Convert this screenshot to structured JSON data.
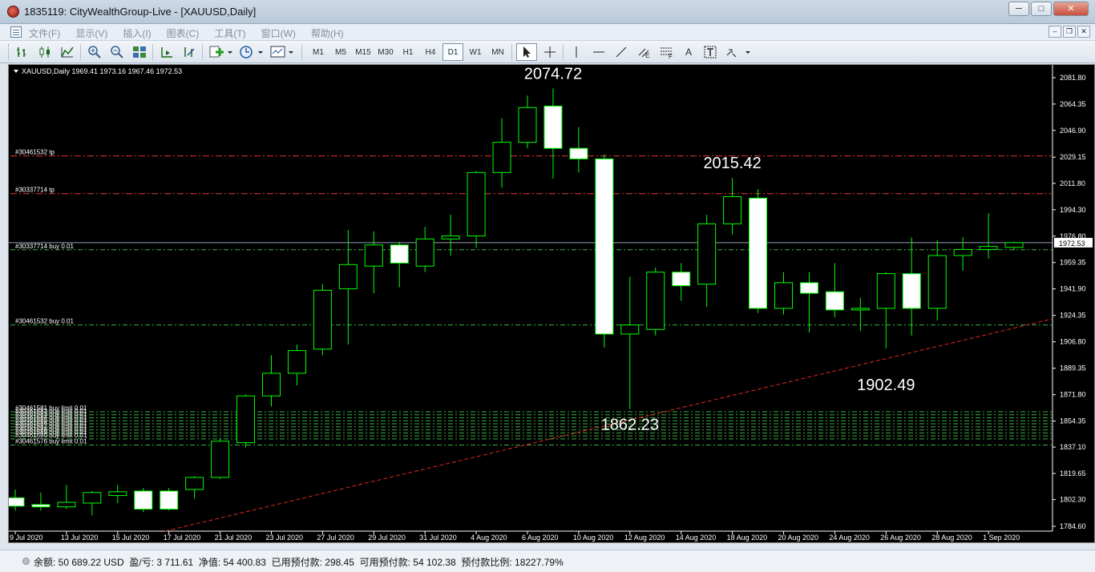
{
  "window": {
    "title": "1835119: CityWealthGroup-Live - [XAUUSD,Daily]"
  },
  "menu": [
    "文件(F)",
    "显示(V)",
    "插入(I)",
    "图表(C)",
    "工具(T)",
    "窗口(W)",
    "帮助(H)"
  ],
  "toolbar": {
    "timeframes": [
      "M1",
      "M5",
      "M15",
      "M30",
      "H1",
      "H4",
      "D1",
      "W1",
      "MN"
    ],
    "active_timeframe": "D1",
    "text_tool_label": "A"
  },
  "chart": {
    "symbol_info": "XAUUSD,Daily  1969.41 1973.16 1967.46 1972.53",
    "current_price": "1972.53",
    "colors": {
      "background": "#000000",
      "candle_outline": "#00ff00",
      "bull_body": "#000000",
      "bear_body": "#ffffff",
      "order_line": "#3cb043",
      "tp_line": "#e03a2a",
      "trendline": "#e0281e",
      "bid_line": "#8fa0b8"
    },
    "price_axis": [
      "2081.80",
      "2064.35",
      "2046.90",
      "2029.15",
      "2011.80",
      "1994.30",
      "1976.80",
      "1959.35",
      "1941.90",
      "1924.35",
      "1906.80",
      "1889.35",
      "1871.80",
      "1854.35",
      "1837.10",
      "1819.65",
      "1802.30",
      "1784.60"
    ],
    "date_axis": [
      "9 Jul 2020",
      "13 Jul 2020",
      "15 Jul 2020",
      "17 Jul 2020",
      "21 Jul 2020",
      "23 Jul 2020",
      "27 Jul 2020",
      "29 Jul 2020",
      "31 Jul 2020",
      "4 Aug 2020",
      "6 Aug 2020",
      "10 Aug 2020",
      "12 Aug 2020",
      "14 Aug 2020",
      "18 Aug 2020",
      "20 Aug 2020",
      "24 Aug 2020",
      "26 Aug 2020",
      "28 Aug 2020",
      "1 Sep 2020"
    ],
    "annotations": [
      {
        "text": "2074.72"
      },
      {
        "text": "2015.42"
      },
      {
        "text": "1862.23"
      },
      {
        "text": "1902.49"
      }
    ],
    "order_lines": [
      {
        "label": "#30461532 tp",
        "price": 2030.0,
        "kind": "tp"
      },
      {
        "label": "#30337714 tp",
        "price": 2005.0,
        "kind": "tp"
      },
      {
        "label": "#30337714 buy 0.01",
        "price": 1967.8,
        "kind": "order"
      },
      {
        "label": "#30461532 buy 0.01",
        "price": 1918.0,
        "kind": "order"
      },
      {
        "label": "#30461581 buy limit 0.01",
        "price": 1860.5,
        "kind": "order"
      },
      {
        "label": "#30461582 buy limit 0.01",
        "price": 1858.5,
        "kind": "order"
      },
      {
        "label": "#30461583 buy limit 0.01",
        "price": 1856.5,
        "kind": "order"
      },
      {
        "label": "#30461584 buy limit 0.01",
        "price": 1854.5,
        "kind": "order"
      },
      {
        "label": "#30461585 buy limit 0.01",
        "price": 1852.5,
        "kind": "order"
      },
      {
        "label": "#30461586 buy limit 0.01",
        "price": 1850.5,
        "kind": "order"
      },
      {
        "label": "#30461587 buy limit 0.01",
        "price": 1848.5,
        "kind": "order"
      },
      {
        "label": "#30461588 buy limit 0.01",
        "price": 1846.5,
        "kind": "order"
      },
      {
        "label": "#30461589 buy limit 0.01",
        "price": 1844.5,
        "kind": "order"
      },
      {
        "label": "#30461590 buy limit 0.01",
        "price": 1842.5,
        "kind": "order"
      },
      {
        "label": "#30461576 buy limit 0.01",
        "price": 1838.5,
        "kind": "order"
      }
    ],
    "candles": [
      {
        "date": "9 Jul 2020",
        "o": 1803.5,
        "h": 1809.0,
        "l": 1795.0,
        "c": 1798.0
      },
      {
        "date": "10 Jul 2020",
        "o": 1799.0,
        "h": 1807.0,
        "l": 1795.0,
        "c": 1797.5
      },
      {
        "date": "13 Jul 2020",
        "o": 1797.5,
        "h": 1812.0,
        "l": 1796.0,
        "c": 1800.5
      },
      {
        "date": "14 Jul 2020",
        "o": 1800.0,
        "h": 1808.0,
        "l": 1792.0,
        "c": 1807.0
      },
      {
        "date": "15 Jul 2020",
        "o": 1805.0,
        "h": 1812.0,
        "l": 1800.0,
        "c": 1807.5
      },
      {
        "date": "16 Jul 2020",
        "o": 1808.0,
        "h": 1810.0,
        "l": 1794.0,
        "c": 1796.0
      },
      {
        "date": "17 Jul 2020",
        "o": 1808.0,
        "h": 1810.0,
        "l": 1795.0,
        "c": 1796.0
      },
      {
        "date": "20 Jul 2020",
        "o": 1809.0,
        "h": 1818.0,
        "l": 1803.0,
        "c": 1817.0
      },
      {
        "date": "21 Jul 2020",
        "o": 1817.0,
        "h": 1843.0,
        "l": 1816.0,
        "c": 1841.0
      },
      {
        "date": "22 Jul 2020",
        "o": 1840.0,
        "h": 1872.0,
        "l": 1837.0,
        "c": 1871.0
      },
      {
        "date": "23 Jul 2020",
        "o": 1871.0,
        "h": 1898.0,
        "l": 1864.0,
        "c": 1886.0
      },
      {
        "date": "24 Jul 2020",
        "o": 1886.0,
        "h": 1905.0,
        "l": 1878.0,
        "c": 1901.0
      },
      {
        "date": "27 Jul 2020",
        "o": 1902.0,
        "h": 1945.0,
        "l": 1898.0,
        "c": 1941.0
      },
      {
        "date": "28 Jul 2020",
        "o": 1942.0,
        "h": 1981.0,
        "l": 1905.0,
        "c": 1958.0
      },
      {
        "date": "29 Jul 2020",
        "o": 1957.0,
        "h": 1980.0,
        "l": 1939.0,
        "c": 1971.0
      },
      {
        "date": "30 Jul 2020",
        "o": 1971.0,
        "h": 1973.0,
        "l": 1943.0,
        "c": 1959.0
      },
      {
        "date": "31 Jul 2020",
        "o": 1957.0,
        "h": 1983.0,
        "l": 1953.0,
        "c": 1975.0
      },
      {
        "date": "3 Aug 2020",
        "o": 1975.0,
        "h": 1991.0,
        "l": 1964.0,
        "c": 1977.0
      },
      {
        "date": "4 Aug 2020",
        "o": 1977.0,
        "h": 2020.0,
        "l": 1969.0,
        "c": 2019.0
      },
      {
        "date": "5 Aug 2020",
        "o": 2019.0,
        "h": 2055.0,
        "l": 2009.0,
        "c": 2039.0
      },
      {
        "date": "6 Aug 2020",
        "o": 2039.0,
        "h": 2070.0,
        "l": 2035.0,
        "c": 2062.0
      },
      {
        "date": "7 Aug 2020",
        "o": 2063.0,
        "h": 2074.72,
        "l": 2015.0,
        "c": 2035.0
      },
      {
        "date": "10 Aug 2020",
        "o": 2035.0,
        "h": 2049.0,
        "l": 2019.0,
        "c": 2028.0
      },
      {
        "date": "11 Aug 2020",
        "o": 2028.0,
        "h": 2031.0,
        "l": 1903.0,
        "c": 1912.0
      },
      {
        "date": "12 Aug 2020",
        "o": 1912.0,
        "h": 1950.0,
        "l": 1862.23,
        "c": 1918.0
      },
      {
        "date": "13 Aug 2020",
        "o": 1915.0,
        "h": 1956.0,
        "l": 1911.0,
        "c": 1953.0
      },
      {
        "date": "14 Aug 2020",
        "o": 1953.0,
        "h": 1959.0,
        "l": 1934.0,
        "c": 1944.0
      },
      {
        "date": "17 Aug 2020",
        "o": 1945.0,
        "h": 1991.0,
        "l": 1930.0,
        "c": 1985.0
      },
      {
        "date": "18 Aug 2020",
        "o": 1985.0,
        "h": 2015.42,
        "l": 1978.0,
        "c": 2003.0
      },
      {
        "date": "19 Aug 2020",
        "o": 2002.0,
        "h": 2008.0,
        "l": 1926.0,
        "c": 1929.0
      },
      {
        "date": "20 Aug 2020",
        "o": 1929.0,
        "h": 1953.0,
        "l": 1925.0,
        "c": 1946.0
      },
      {
        "date": "21 Aug 2020",
        "o": 1946.0,
        "h": 1953.0,
        "l": 1913.0,
        "c": 1939.0
      },
      {
        "date": "24 Aug 2020",
        "o": 1940.0,
        "h": 1959.0,
        "l": 1923.0,
        "c": 1928.0
      },
      {
        "date": "25 Aug 2020",
        "o": 1928.0,
        "h": 1936.0,
        "l": 1914.0,
        "c": 1929.0
      },
      {
        "date": "26 Aug 2020",
        "o": 1929.0,
        "h": 1953.0,
        "l": 1902.49,
        "c": 1952.0
      },
      {
        "date": "27 Aug 2020",
        "o": 1952.0,
        "h": 1976.0,
        "l": 1911.0,
        "c": 1929.0
      },
      {
        "date": "28 Aug 2020",
        "o": 1929.0,
        "h": 1974.0,
        "l": 1921.0,
        "c": 1964.0
      },
      {
        "date": "31 Aug 2020",
        "o": 1964.0,
        "h": 1976.0,
        "l": 1954.0,
        "c": 1968.0
      },
      {
        "date": "1 Sep 2020",
        "o": 1968.0,
        "h": 1992.0,
        "l": 1962.0,
        "c": 1970.0
      },
      {
        "date": "2 Sep 2020",
        "o": 1969.41,
        "h": 1973.16,
        "l": 1967.46,
        "c": 1972.53
      }
    ]
  },
  "status": {
    "text": "余额: 50 689.22 USD  盈/亏: 3 711.61  净值: 54 400.83  已用预付款: 298.45  可用预付款: 54 102.38  预付款比例: 18227.79%"
  }
}
